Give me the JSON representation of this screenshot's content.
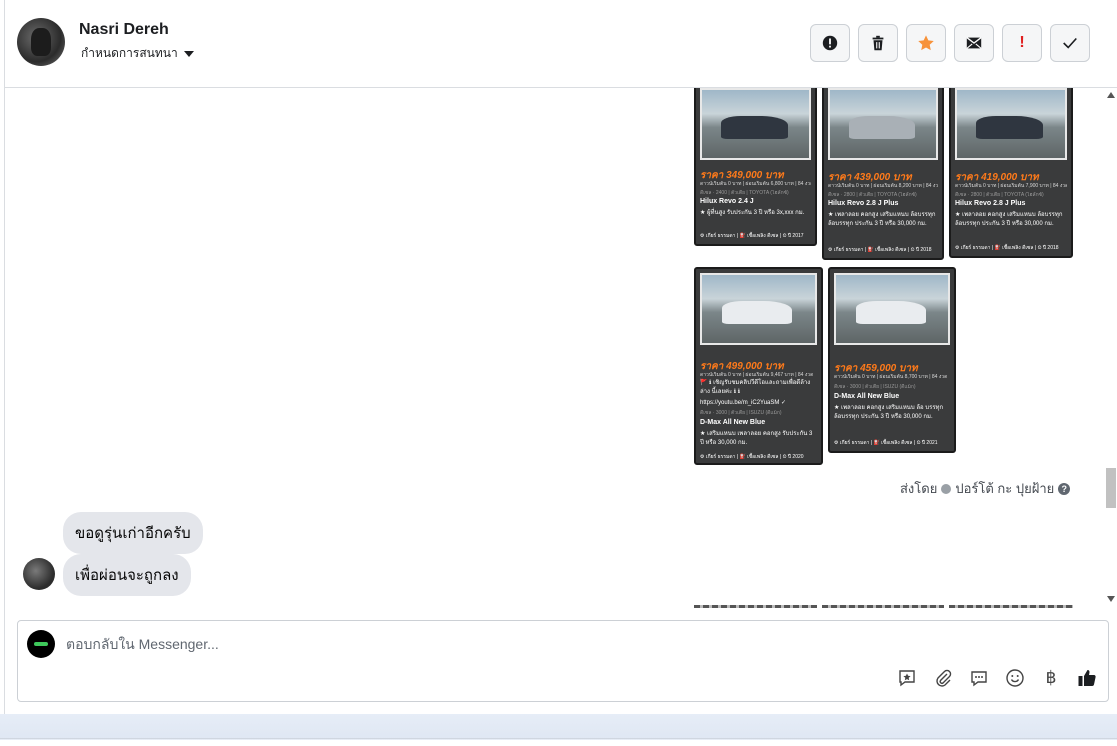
{
  "header": {
    "contact_name": "Nasri Dereh",
    "assign_label": "กำหนดการสนทนา"
  },
  "actions": [
    {
      "name": "flag-button",
      "icon": "exclamation-circle-icon"
    },
    {
      "name": "delete-button",
      "icon": "trash-icon"
    },
    {
      "name": "star-button",
      "icon": "star-icon",
      "color": "#f7923a"
    },
    {
      "name": "mark-unread-button",
      "icon": "envelope-icon"
    },
    {
      "name": "spam-button",
      "icon": "exclamation-icon",
      "color": "#e02020"
    },
    {
      "name": "mark-done-button",
      "icon": "check-icon"
    }
  ],
  "listings": [
    {
      "price": "ราคา 349,000 บาท",
      "finance": "ดาวน์เริ่มต้น 0 บาท | ผ่อนเริ่มต้น 6,800 บาท | 84 งวด",
      "specs": "ดีเซล · 2400 | ตัวเตี้ย | TOYOTA (ไฮลักซ์)",
      "model": "Hilux Revo 2.4 J",
      "desc": "★ ผู้ที่นสูง รับประกัน 3 ปี หรือ 3x,xxx กม.",
      "footer": "⚙ เกียร์ ธรรมดา | ⛽ เชื้อเพลิง ดีเซล | ⏲ ปี 2017"
    },
    {
      "price": "ราคา 439,000 บาท",
      "finance": "ดาวน์เริ่มต้น 0 บาท | ผ่อนเริ่มต้น 8,200 บาท | 84 งวด",
      "specs": "ดีเซล · 2800 | ตัวเตี้ย | TOYOTA (ไฮลักซ์)",
      "model": "Hilux Revo 2.8 J Plus",
      "desc": "★ เพลาลอย คอกสูง เสริมแหนบ ล้อบรรทุก ล้อบรรทุก ประกัน 3 ปี หรือ 30,000 กม.",
      "footer": "⚙ เกียร์ ธรรมดา | ⛽ เชื้อเพลิง ดีเซล | ⏲ ปี 2018"
    },
    {
      "price": "ราคา 419,000 บาท",
      "finance": "ดาวน์เริ่มต้น 0 บาท | ผ่อนเริ่มต้น 7,900 บาท | 84 งวด",
      "specs": "ดีเซล · 2800 | ตัวเตี้ย | TOYOTA (ไฮลักซ์)",
      "model": "Hilux Revo 2.8 J Plus",
      "desc": "★ เพลาลอย คอกสูง เสริมแหนบ ล้อบรรทุก ล้อบรรทุก ประกัน 3 ปี หรือ 30,000 กม.",
      "footer": "⚙ เกียร์ ธรรมดา | ⛽ เชื้อเพลิง ดีเซล | ⏲ ปี 2018"
    },
    {
      "price": "ราคา 499,000 บาท",
      "finance": "ดาวน์เริ่มต้น 0 บาท | ผ่อนเริ่มต้น 9,467 บาท | 84 งวด",
      "note": "🚩 ℹ เชิญรับชมคลิปวีดีโอและถามเพื่อดีล้าง ล่าง นี้เลยค่ะ ℹ ℹ",
      "link": "https://youtu.be/m_iC2YuaSM ✓",
      "specs": "ดีเซล · 3000 | ตัวเตี้ย | ISUZU (ดีแม็ก)",
      "model": "D-Max All New Blue",
      "desc": "★ เสริมแหนบ เพลาลอย คอกสูง รับประกัน 3 ปี หรือ 30,000 กม.",
      "footer": "⚙ เกียร์ ธรรมดา | ⛽ เชื้อเพลิง ดีเซล | ⏲ ปี 2020"
    },
    {
      "price": "ราคา 459,000 บาท",
      "finance": "ดาวน์เริ่มต้น 0 บาท | ผ่อนเริ่มต้น 8,700 บาท | 84 งวด",
      "specs": "ดีเซล · 3000 | ตัวเตี้ย | ISUZU (ดีแม็ก)",
      "model": "D-Max All New Blue",
      "desc": "★ เพลาลอย คอกสูง เสริมแหนบ ล้อ บรรทุก ล้อบรรทุก ประกัน 3 ปี หรือ 30,000 กม.",
      "footer": "⚙ เกียร์ ธรรมดา | ⛽ เชื้อเพลิง ดีเซล | ⏲ ปี 2021"
    }
  ],
  "sent_by": {
    "prefix": "ส่งโดย",
    "sender": "ปอร์โต้ กะ ปุยฝ้าย"
  },
  "messages": [
    {
      "text": "ขอดูรุ่นเก่าอีกครับ"
    },
    {
      "text": "เพื่อผ่อนจะถูกลง"
    }
  ],
  "composer": {
    "placeholder": "ตอบกลับใน Messenger...",
    "tools": [
      "saved-reply-icon",
      "attachment-icon",
      "chat-bubble-icon",
      "emoji-icon",
      "baht-icon",
      "thumbs-up-icon"
    ]
  }
}
